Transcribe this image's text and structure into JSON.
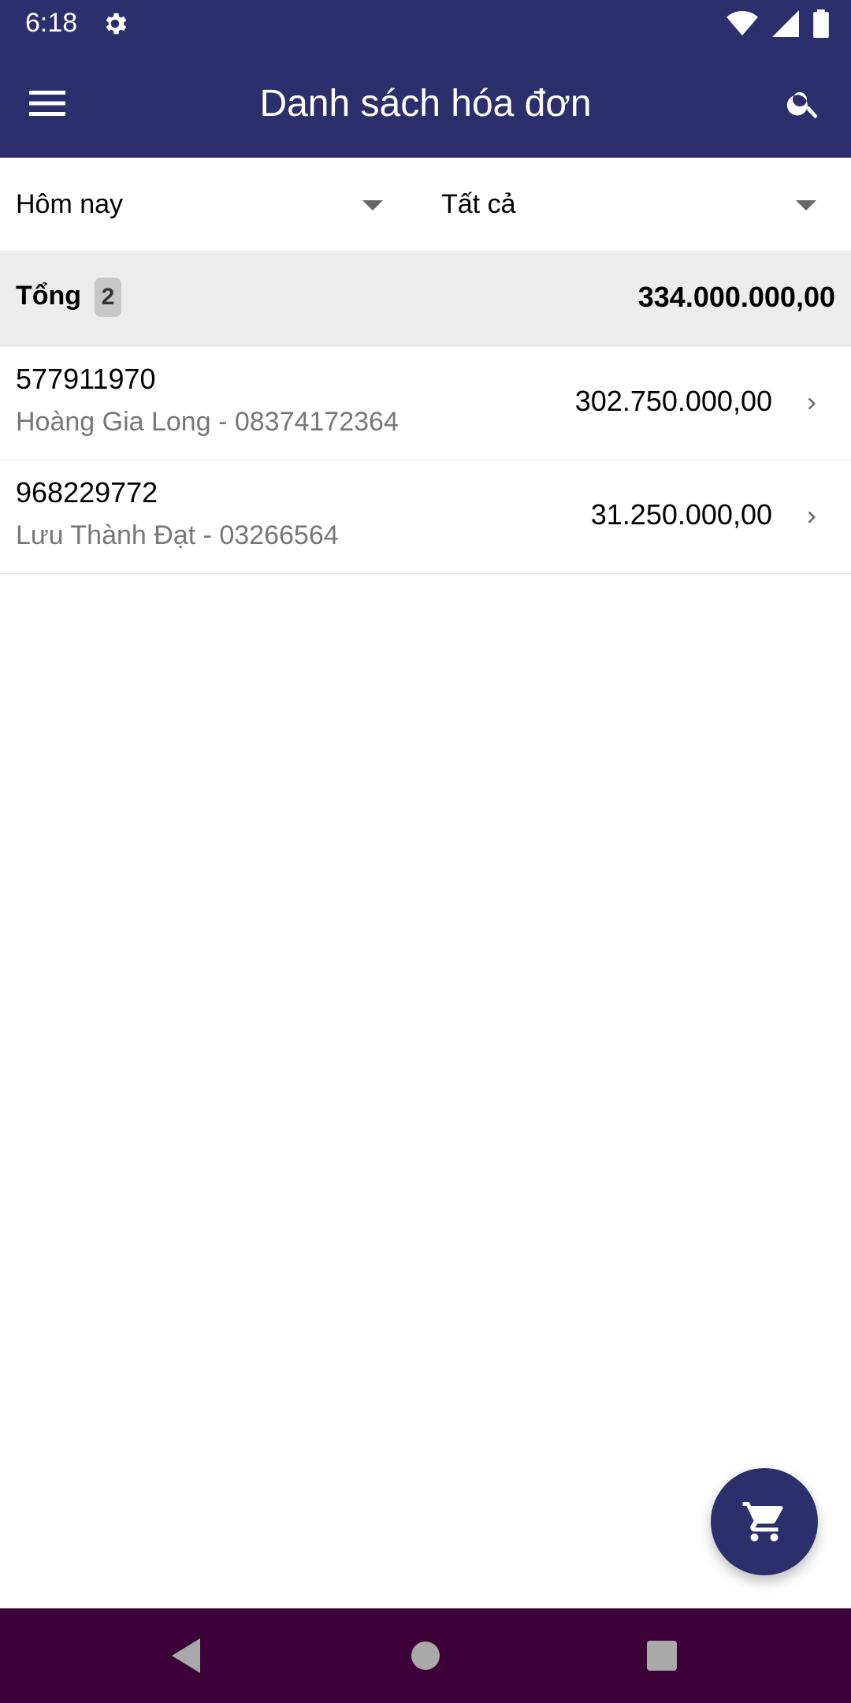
{
  "status_bar": {
    "time": "6:18",
    "icons": [
      "gear-icon",
      "wifi-icon",
      "signal-icon",
      "battery-icon"
    ]
  },
  "app_bar": {
    "title": "Danh sách hóa đơn",
    "menu_icon": "menu-icon",
    "search_icon": "search-icon"
  },
  "filters": {
    "date": "Hôm nay",
    "status": "Tất cả"
  },
  "summary": {
    "label": "Tổng",
    "count": "2",
    "total": "334.000.000,00"
  },
  "invoices": [
    {
      "code": "577911970",
      "customer": "Hoàng Gia Long - 08374172364",
      "amount": "302.750.000,00"
    },
    {
      "code": "968229772",
      "customer": "Lưu Thành Đạt - 03266564",
      "amount": "31.250.000,00"
    }
  ],
  "fab": {
    "icon": "cart-icon"
  },
  "nav": {
    "back": "back-icon",
    "home": "home-icon",
    "recents": "recents-icon"
  },
  "colors": {
    "primary": "#2b2f6b",
    "nav_bar": "#3d0038",
    "summary_bg": "#ececec"
  }
}
